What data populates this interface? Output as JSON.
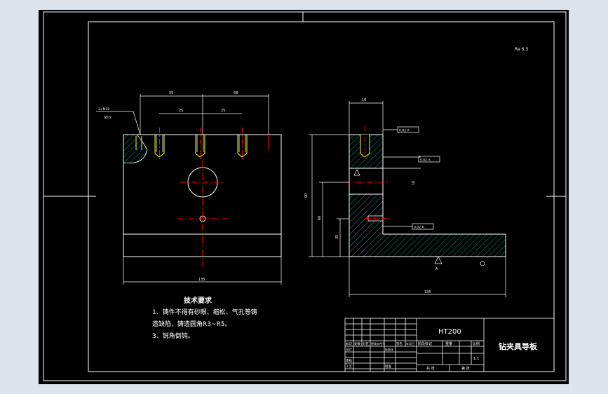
{
  "drawing": {
    "roughness_note": "Ra 6.3",
    "dimensions": {
      "top_left_span": "55",
      "top_right_span": "58",
      "hole_pitch_1": "25",
      "hole_pitch_2": "25",
      "front_width": "135",
      "side_width": "135",
      "side_height_total": "90",
      "side_height_mid": "60",
      "side_height_low": "35",
      "side_top_hole": "16",
      "side_small": "10"
    },
    "callouts": {
      "hole_spec_1": "3×M10",
      "hole_spec_2": "深15",
      "tol_1": "0.02 A",
      "tol_2": "0.02 A",
      "tol_3": "0.02 A",
      "datum": "A"
    }
  },
  "tech_requirements": {
    "title": "技术要求",
    "line1": "1、铸件不得有砂眼、缩松、气孔等铸",
    "line2": "造缺陷，铸造圆角R3~R5。",
    "line3": "3、锐角倒钝。"
  },
  "title_block": {
    "material": "HT200",
    "drawing_name": "钻夹具导板",
    "scale_label": "比例",
    "scale_value": "1:1",
    "row_labels": [
      "标记",
      "处数",
      "分区",
      "更改文件号",
      "签名",
      "年月日"
    ],
    "left_labels": [
      "设计",
      "审核",
      "工艺"
    ],
    "mid_labels": [
      "标准化",
      "批准"
    ],
    "stage_label": "阶段标记",
    "weight_label": "重量",
    "sheet_total": "共 张",
    "sheet_num": "第 张"
  },
  "colors": {
    "background": "#000000",
    "outline": "#ffffff",
    "center_line": "#ff0000",
    "dimension": "#ffffff",
    "hatch": "#00c0c0",
    "thread": "#ffff00",
    "annotation": "#ffffff"
  }
}
